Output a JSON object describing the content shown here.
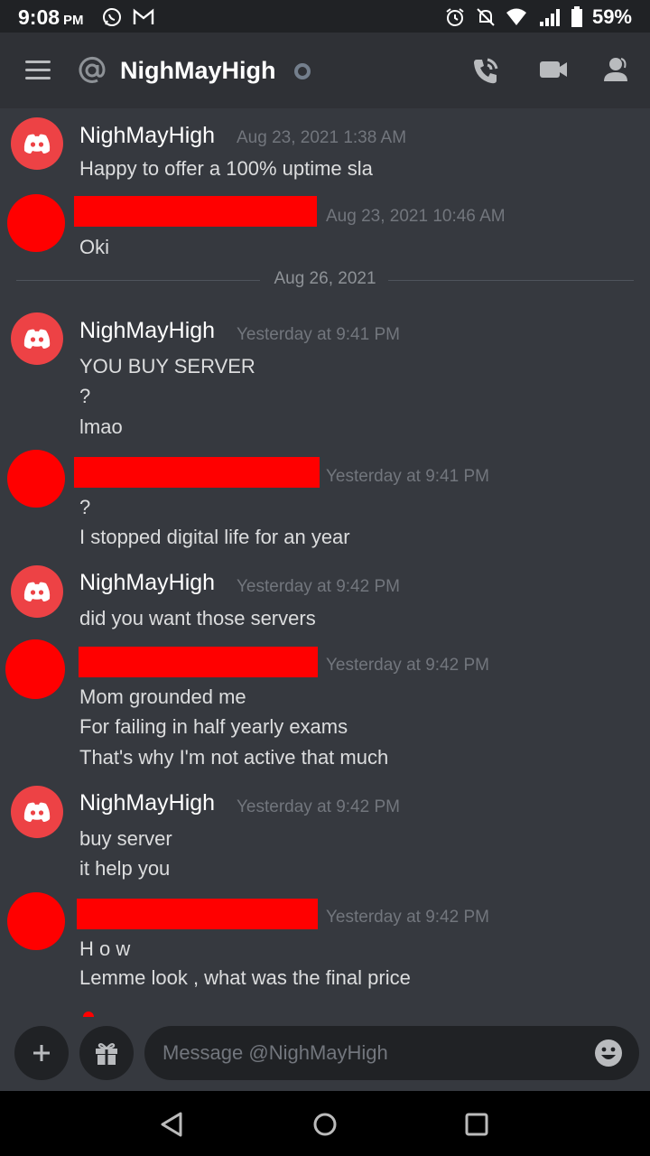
{
  "status_bar": {
    "time": "9:08",
    "ampm": "PM",
    "battery": "59%",
    "icons": [
      "whatsapp-icon",
      "gmail-icon",
      "alarm-icon",
      "mute-icon",
      "wifi-icon",
      "signal-icon",
      "battery-icon"
    ]
  },
  "header": {
    "channel_name": "NighMayHigh",
    "icons": [
      "menu-icon",
      "at-icon",
      "call-icon",
      "video-icon",
      "members-icon"
    ]
  },
  "messages": [
    {
      "author": "NighMayHigh",
      "timestamp": "Aug 23, 2021 1:38 AM",
      "lines": [
        "Happy to offer a 100% uptime sla"
      ]
    },
    {
      "author": "",
      "redacted": true,
      "timestamp": "Aug 23, 2021 10:46 AM",
      "lines": [
        "Oki"
      ]
    },
    {
      "divider": "Aug 26, 2021"
    },
    {
      "author": "NighMayHigh",
      "timestamp": "Yesterday at 9:41 PM",
      "lines": [
        "YOU BUY SERVER",
        "?",
        "lmao"
      ]
    },
    {
      "author": "",
      "redacted": true,
      "timestamp": "Yesterday at 9:41 PM",
      "lines": [
        "?",
        "I stopped digital life for an year"
      ]
    },
    {
      "author": "NighMayHigh",
      "timestamp": "Yesterday at 9:42 PM",
      "lines": [
        "did you want those servers"
      ]
    },
    {
      "author": "",
      "redacted": true,
      "timestamp": "Yesterday at 9:42 PM",
      "lines": [
        "Mom grounded me",
        "For failing in half yearly exams",
        "That's why I'm not active that much"
      ]
    },
    {
      "author": "NighMayHigh",
      "timestamp": "Yesterday at 9:42 PM",
      "lines": [
        "buy server",
        "it help you"
      ]
    },
    {
      "author": "",
      "redacted": true,
      "timestamp": "Yesterday at 9:42 PM",
      "lines": [
        "H o w",
        "Lemme look , what was the final price"
      ]
    }
  ],
  "composer": {
    "placeholder": "Message @NighMayHigh"
  },
  "colors": {
    "background": "#36393f",
    "header": "#2f3136",
    "discord_red": "#ed4245",
    "redaction": "#ff0000"
  }
}
